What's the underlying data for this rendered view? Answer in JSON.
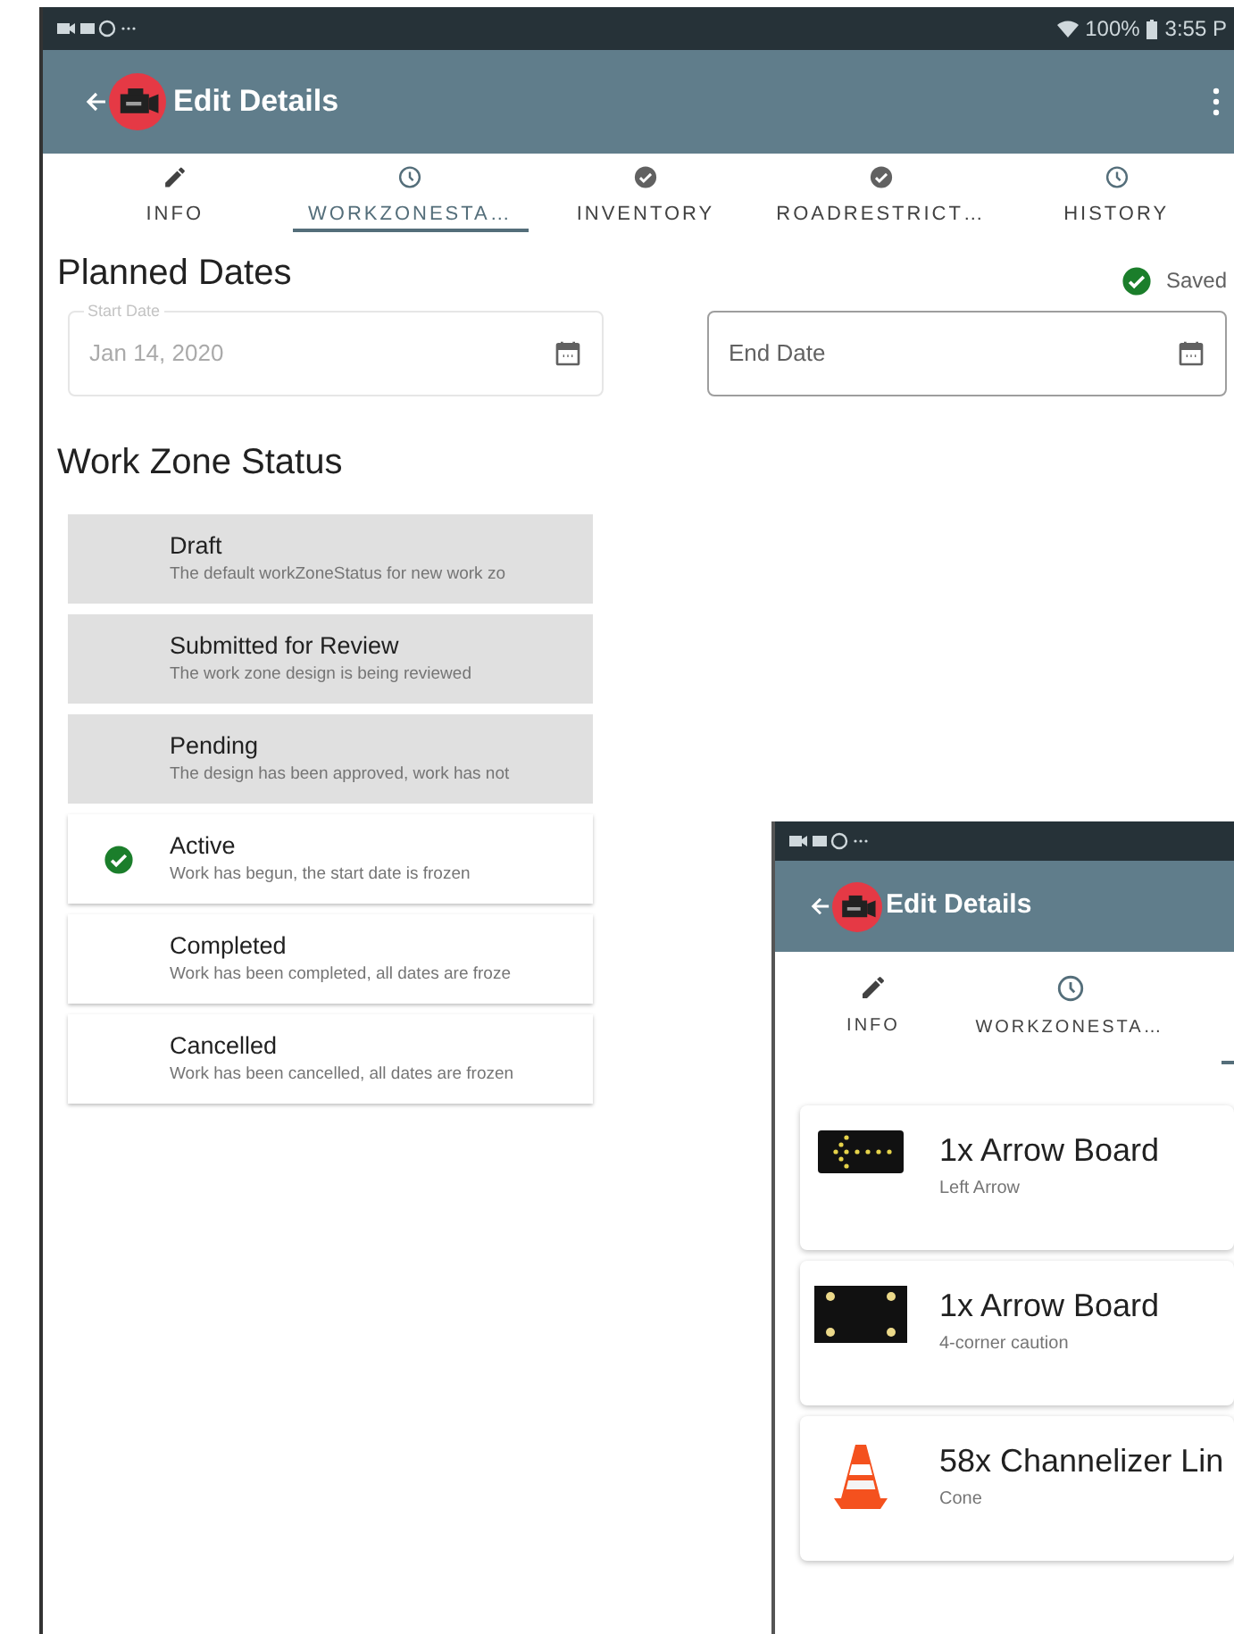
{
  "status_bar": {
    "battery": "100%",
    "time": "3:55 P"
  },
  "app_bar": {
    "title": "Edit Details"
  },
  "tabs": [
    {
      "label": "INFO",
      "kind": "pencil",
      "selected": false
    },
    {
      "label": "WORKZONESTA…",
      "kind": "clock",
      "selected": true
    },
    {
      "label": "INVENTORY",
      "kind": "check",
      "selected": false
    },
    {
      "label": "ROADRESTRICT…",
      "kind": "check",
      "selected": false
    },
    {
      "label": "HISTORY",
      "kind": "clock",
      "selected": false
    }
  ],
  "planned_dates": {
    "title": "Planned Dates",
    "saved": "Saved",
    "start_date": {
      "label": "Start Date",
      "value": "Jan 14, 2020",
      "disabled": true
    },
    "end_date": {
      "placeholder": "End Date",
      "disabled": false
    }
  },
  "work_zone_status": {
    "title": "Work Zone Status",
    "items": [
      {
        "name": "Draft",
        "description": "The default workZoneStatus for new work zo",
        "kind": "done",
        "selected": false
      },
      {
        "name": "Submitted for Review",
        "description": "The work zone design is being reviewed",
        "kind": "done",
        "selected": false
      },
      {
        "name": "Pending",
        "description": "The design has been approved, work has not",
        "kind": "done",
        "selected": false
      },
      {
        "name": "Active",
        "description": "Work has begun, the start date is frozen",
        "kind": "open",
        "selected": true
      },
      {
        "name": "Completed",
        "description": "Work has been completed, all dates are froze",
        "kind": "open",
        "selected": false
      },
      {
        "name": "Cancelled",
        "description": "Work has been cancelled, all dates are frozen",
        "kind": "open",
        "selected": false
      }
    ]
  },
  "second_screen": {
    "app_bar": {
      "title": "Edit Details"
    },
    "tabs": [
      {
        "label": "INFO",
        "kind": "pencil"
      },
      {
        "label": "WORKZONESTA…",
        "kind": "clock"
      }
    ],
    "inventory": [
      {
        "title": "1x Arrow Board",
        "subtitle": "Left Arrow",
        "kind": "arrow"
      },
      {
        "title": "1x Arrow Board",
        "subtitle": "4-corner caution",
        "kind": "corners"
      },
      {
        "title": "58x Channelizer Lin",
        "subtitle": "Cone",
        "kind": "cone"
      }
    ]
  }
}
